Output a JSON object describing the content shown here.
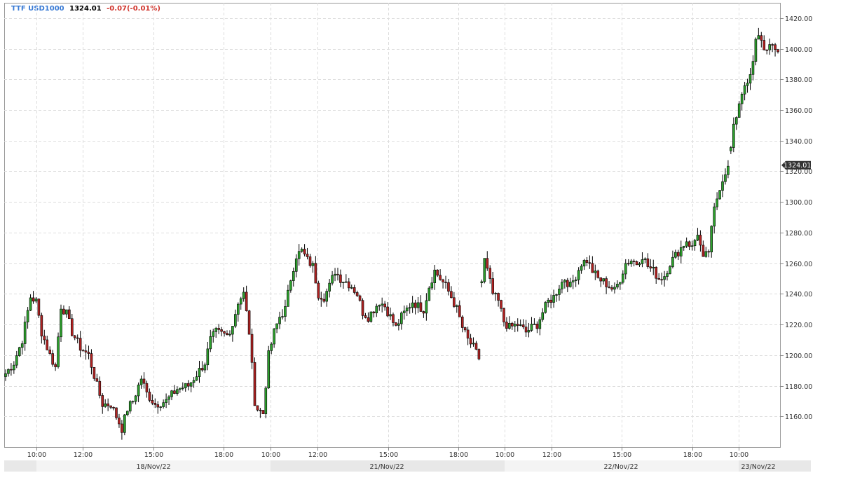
{
  "header": {
    "symbol": "TTF USD1000",
    "last": "1324.01",
    "change": "-0.07(-0.01%)",
    "symbol_color": "#3a7bd5",
    "change_color": "#d0342c"
  },
  "chart_data": {
    "type": "candlestick",
    "ylim": [
      1140,
      1430
    ],
    "y_ticks": [
      "1160.00",
      "1180.00",
      "1200.00",
      "1220.00",
      "1240.00",
      "1260.00",
      "1280.00",
      "1300.00",
      "1320.00",
      "1340.00",
      "1360.00",
      "1380.00",
      "1400.00",
      "1420.00"
    ],
    "price_tag": "1324.01",
    "time_ticks": [
      "10:00",
      "12:00",
      "15:00",
      "18:00",
      "10:00",
      "12:00",
      "15:00",
      "18:00",
      "10:00",
      "12:00",
      "15:00",
      "18:00",
      "10:00"
    ],
    "date_labels": [
      "18/Nov/22",
      "21/Nov/22",
      "22/Nov/22",
      "23/Nov/22"
    ],
    "up_color": "#2ca02c",
    "down_color": "#b22222",
    "grid": true,
    "close_path": [
      [
        0,
        1188
      ],
      [
        3,
        1195
      ],
      [
        6,
        1210
      ],
      [
        9,
        1238
      ],
      [
        11,
        1235
      ],
      [
        13,
        1215
      ],
      [
        16,
        1200
      ],
      [
        18,
        1192
      ],
      [
        20,
        1232
      ],
      [
        22,
        1227
      ],
      [
        24,
        1215
      ],
      [
        27,
        1205
      ],
      [
        30,
        1200
      ],
      [
        33,
        1180
      ],
      [
        35,
        1168
      ],
      [
        38,
        1168
      ],
      [
        40,
        1160
      ],
      [
        42,
        1152
      ],
      [
        44,
        1165
      ],
      [
        46,
        1170
      ],
      [
        49,
        1185
      ],
      [
        51,
        1175
      ],
      [
        54,
        1168
      ],
      [
        58,
        1170
      ],
      [
        62,
        1178
      ],
      [
        66,
        1180
      ],
      [
        70,
        1190
      ],
      [
        72,
        1195
      ],
      [
        74,
        1210
      ],
      [
        76,
        1215
      ],
      [
        80,
        1213
      ],
      [
        82,
        1220
      ],
      [
        84,
        1235
      ],
      [
        86,
        1240
      ],
      [
        88,
        1215
      ],
      [
        90,
        1170
      ],
      [
        91,
        1165
      ],
      [
        93,
        1162
      ],
      [
        95,
        1200
      ],
      [
        97,
        1215
      ],
      [
        99,
        1225
      ],
      [
        101,
        1230
      ],
      [
        103,
        1250
      ],
      [
        105,
        1265
      ],
      [
        107,
        1268
      ],
      [
        109,
        1262
      ],
      [
        111,
        1258
      ],
      [
        113,
        1240
      ],
      [
        115,
        1238
      ],
      [
        117,
        1245
      ],
      [
        119,
        1255
      ],
      [
        121,
        1250
      ],
      [
        123,
        1248
      ],
      [
        125,
        1245
      ],
      [
        127,
        1240
      ],
      [
        129,
        1228
      ],
      [
        131,
        1225
      ],
      [
        133,
        1230
      ],
      [
        135,
        1235
      ],
      [
        137,
        1232
      ],
      [
        139,
        1225
      ],
      [
        141,
        1218
      ],
      [
        143,
        1225
      ],
      [
        145,
        1230
      ],
      [
        147,
        1235
      ],
      [
        149,
        1232
      ],
      [
        151,
        1230
      ],
      [
        153,
        1245
      ],
      [
        155,
        1255
      ],
      [
        157,
        1250
      ],
      [
        159,
        1245
      ],
      [
        161,
        1238
      ],
      [
        163,
        1230
      ],
      [
        165,
        1218
      ],
      [
        167,
        1210
      ],
      [
        169,
        1205
      ],
      [
        171,
        1198
      ],
      [
        172,
        1248
      ],
      [
        173,
        1262
      ],
      [
        174,
        1255
      ],
      [
        176,
        1240
      ],
      [
        178,
        1235
      ],
      [
        180,
        1222
      ],
      [
        182,
        1218
      ],
      [
        185,
        1220
      ],
      [
        188,
        1215
      ],
      [
        190,
        1218
      ],
      [
        192,
        1220
      ],
      [
        194,
        1228
      ],
      [
        196,
        1235
      ],
      [
        198,
        1238
      ],
      [
        200,
        1245
      ],
      [
        202,
        1250
      ],
      [
        204,
        1245
      ],
      [
        206,
        1252
      ],
      [
        208,
        1260
      ],
      [
        210,
        1262
      ],
      [
        212,
        1255
      ],
      [
        214,
        1250
      ],
      [
        216,
        1248
      ],
      [
        218,
        1245
      ],
      [
        220,
        1242
      ],
      [
        222,
        1250
      ],
      [
        224,
        1260
      ],
      [
        226,
        1262
      ],
      [
        228,
        1260
      ],
      [
        230,
        1265
      ],
      [
        232,
        1258
      ],
      [
        234,
        1255
      ],
      [
        236,
        1250
      ],
      [
        238,
        1252
      ],
      [
        240,
        1260
      ],
      [
        242,
        1265
      ],
      [
        244,
        1270
      ],
      [
        246,
        1275
      ],
      [
        248,
        1270
      ],
      [
        250,
        1280
      ],
      [
        252,
        1262
      ],
      [
        254,
        1268
      ],
      [
        256,
        1295
      ],
      [
        258,
        1310
      ],
      [
        260,
        1320
      ],
      [
        261,
        1322
      ],
      [
        262,
        1335
      ],
      [
        263,
        1348
      ],
      [
        265,
        1365
      ],
      [
        267,
        1378
      ],
      [
        268,
        1375
      ],
      [
        270,
        1390
      ],
      [
        271,
        1405
      ],
      [
        272,
        1410
      ],
      [
        273,
        1405
      ],
      [
        275,
        1398
      ],
      [
        277,
        1402
      ],
      [
        279,
        1399
      ]
    ]
  }
}
